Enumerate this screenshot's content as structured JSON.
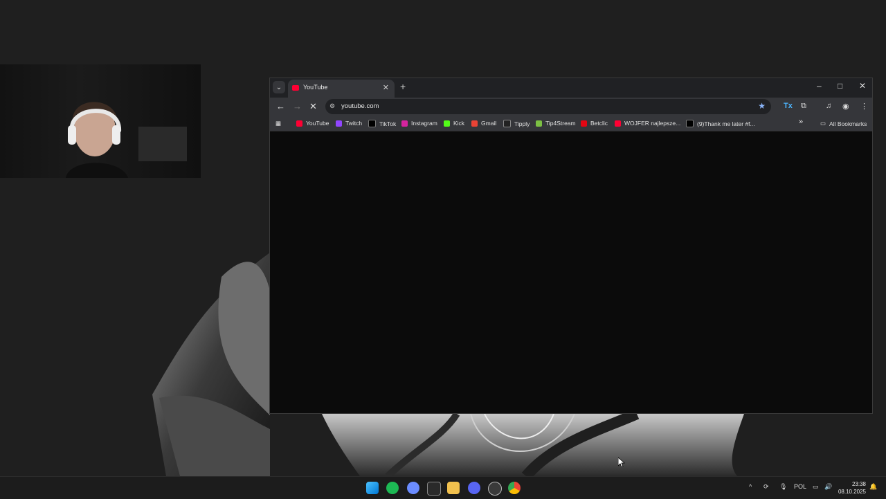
{
  "browser": {
    "tab": {
      "title": "YouTube",
      "close": "✕"
    },
    "new_tab": "+",
    "window_controls": {
      "minimize": "–",
      "maximize": "□",
      "close": "✕"
    },
    "nav": {
      "back": "←",
      "forward": "→",
      "reload": "✕"
    },
    "address": {
      "url": "youtube.com"
    },
    "bookmarks": [
      {
        "label": "YouTube",
        "color": "#ff0033"
      },
      {
        "label": "Twitch",
        "color": "#9146ff"
      },
      {
        "label": "TikTok",
        "color": "#000000"
      },
      {
        "label": "Instagram",
        "color": "#d6249f"
      },
      {
        "label": "Kick",
        "color": "#53fc18"
      },
      {
        "label": "Gmail",
        "color": "#ea4335"
      },
      {
        "label": "Tipply",
        "color": "#222222"
      },
      {
        "label": "Tip4Stream",
        "color": "#7cc043"
      },
      {
        "label": "Betclic",
        "color": "#e30613"
      },
      {
        "label": "WOJFER najlepsze...",
        "color": "#ff0033"
      },
      {
        "label": "(9)Thank me later #f...",
        "color": "#000000"
      }
    ],
    "more_bookmarks": "»",
    "all_bookmarks": "All Bookmarks"
  },
  "taskbar": {
    "tray_language": "POL",
    "clock_time": "23:38",
    "clock_date": "08.10.2025"
  }
}
